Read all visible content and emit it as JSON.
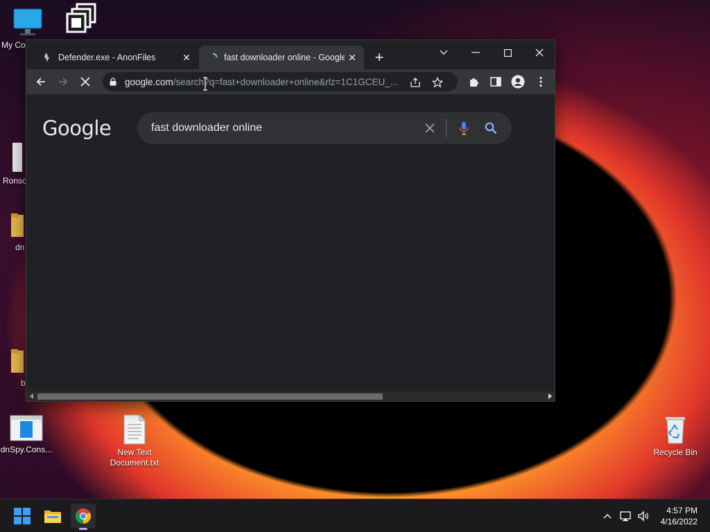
{
  "desktop": {
    "icons": [
      {
        "label": "My Co"
      },
      {
        "label": ""
      },
      {
        "label": "Ronso"
      },
      {
        "label": "dn"
      },
      {
        "label": "b"
      },
      {
        "label": "dnSpy.Cons..."
      },
      {
        "label": "New Text Document.txt"
      },
      {
        "label": "Recycle Bin"
      }
    ]
  },
  "browser": {
    "tabs": [
      {
        "title": "Defender.exe - AnonFiles",
        "active": false
      },
      {
        "title": "fast downloader online - Google",
        "active": true
      }
    ],
    "address": {
      "host": "google.com",
      "path": "/search?q=fast+downloader+online&rlz=1C1GCEU_..."
    },
    "page": {
      "logo": "Google",
      "search_query": "fast downloader online"
    }
  },
  "taskbar": {
    "time": "4:57 PM",
    "date": "4/16/2022"
  },
  "colors": {
    "accent_blue": "#8ab4f8",
    "chrome_dark": "#202124",
    "chrome_toolbar": "#35363a"
  }
}
